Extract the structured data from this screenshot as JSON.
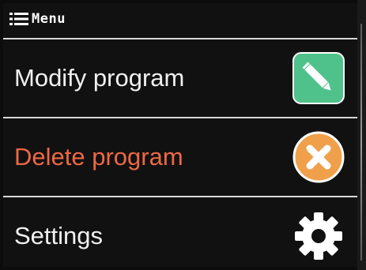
{
  "header": {
    "title": "Menu",
    "icon": "menu-list-icon"
  },
  "menu": {
    "items": [
      {
        "label": "Modify program",
        "icon": "pencil-icon",
        "color": "#f1f1f1",
        "icon_color": "#4ec28a"
      },
      {
        "label": "Delete program",
        "icon": "close-circle-icon",
        "color": "#ee6845",
        "icon_color": "#f0a04a"
      },
      {
        "label": "Settings",
        "icon": "gear-icon",
        "color": "#f1f1f1",
        "icon_color": "#ffffff"
      }
    ]
  }
}
